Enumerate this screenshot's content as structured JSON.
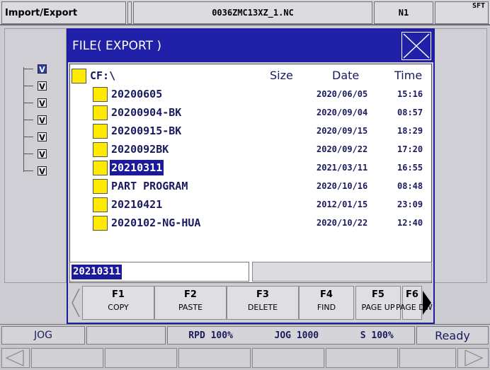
{
  "header": {
    "title": "Import/Export",
    "filename": "0036ZMC13XZ_1.NC",
    "channel": "N1",
    "sft": "SFT"
  },
  "tree": {
    "check_mark": "V"
  },
  "dialog": {
    "title": "FILE( EXPORT )",
    "path": "CF:\\",
    "col_size": "Size",
    "col_date": "Date",
    "col_time": "Time",
    "files": [
      {
        "name": "20200605",
        "date": "2020/06/05",
        "time": "15:16"
      },
      {
        "name": "20200904-BK",
        "date": "2020/09/04",
        "time": "08:57"
      },
      {
        "name": "20200915-BK",
        "date": "2020/09/15",
        "time": "18:29"
      },
      {
        "name": "2020092BK",
        "date": "2020/09/22",
        "time": "17:20"
      },
      {
        "name": "20210311",
        "date": "2021/03/11",
        "time": "16:55"
      },
      {
        "name": "PART PROGRAM",
        "date": "2020/10/16",
        "time": "08:48"
      },
      {
        "name": "20210421",
        "date": "2012/01/15",
        "time": "23:09"
      },
      {
        "name": "2020102-NG-HUA",
        "date": "2020/10/22",
        "time": "12:40"
      }
    ],
    "input_value": "20210311"
  },
  "softkeys": [
    {
      "key": "F1",
      "label": "COPY"
    },
    {
      "key": "F2",
      "label": "PASTE"
    },
    {
      "key": "F3",
      "label": "DELETE"
    },
    {
      "key": "F4",
      "label": "FIND"
    },
    {
      "key": "F5",
      "label": "PAGE UP"
    },
    {
      "key": "F6",
      "label": "PAGE DW"
    }
  ],
  "status": {
    "mode": "JOG",
    "rpd": "RPD 100%",
    "jog": "JOG 1000",
    "s": "S 100%",
    "state": "Ready"
  }
}
